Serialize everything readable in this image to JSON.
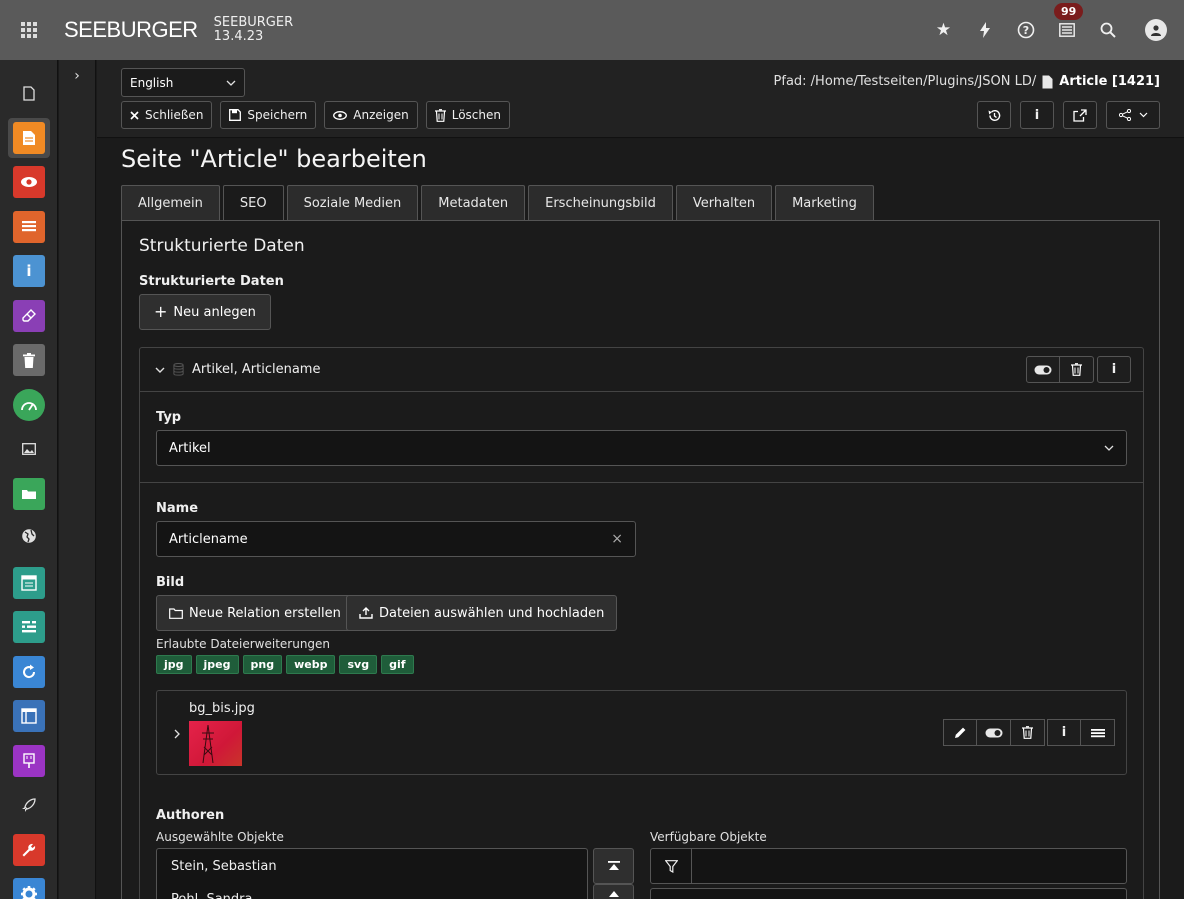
{
  "topbar": {
    "logo": "SEEBURGER",
    "site_name": "SEEBURGER",
    "version": "13.4.23",
    "notification_count": "99"
  },
  "docheader": {
    "language": "English",
    "path_label": "Pfad: /Home/Testseiten/Plugins/JSON LD/",
    "record": "Article [1421]",
    "buttons": {
      "close": "Schließen",
      "save": "Speichern",
      "view": "Anzeigen",
      "delete": "Löschen"
    }
  },
  "page": {
    "title": "Seite \"Article\" bearbeiten",
    "tabs": [
      "Allgemein",
      "SEO",
      "Soziale Medien",
      "Metadaten",
      "Erscheinungsbild",
      "Verhalten",
      "Marketing"
    ],
    "active_tab": "SEO"
  },
  "section": {
    "title": "Strukturierte Daten",
    "field_label": "Strukturierte Daten",
    "new_button": "Neu anlegen"
  },
  "record": {
    "header": "Artikel, Articlename",
    "typ_label": "Typ",
    "typ_value": "Artikel",
    "name_label": "Name",
    "name_value": "Articlename",
    "bild_label": "Bild",
    "relation_button": "Neue Relation erstellen",
    "upload_button": "Dateien auswählen und hochladen",
    "allowed_label": "Erlaubte Dateierweiterungen",
    "extensions": [
      "jpg",
      "jpeg",
      "png",
      "webp",
      "svg",
      "gif"
    ],
    "file_name": "bg_bis.jpg",
    "authors_label": "Authoren",
    "selected_label": "Ausgewählte Objekte",
    "available_label": "Verfügbare Objekte",
    "selected_items": [
      "Stein, Sebastian",
      "Pohl, Sandra"
    ]
  }
}
